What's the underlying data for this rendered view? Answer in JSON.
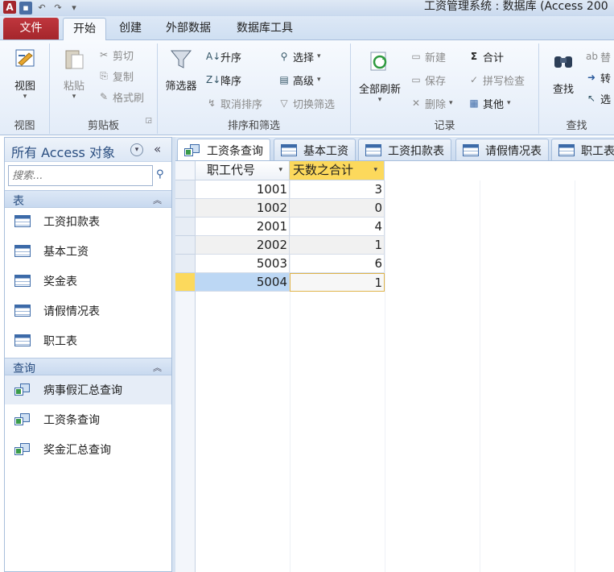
{
  "window": {
    "title": "工资管理系统 : 数据库 (Access 200",
    "app_icon": "A"
  },
  "ribbon_tabs": [
    "文件",
    "开始",
    "创建",
    "外部数据",
    "数据库工具"
  ],
  "ribbon": {
    "view": {
      "label": "视图",
      "group": "视图"
    },
    "clipboard": {
      "paste": "粘贴",
      "cut": "剪切",
      "copy": "复制",
      "format_painter": "格式刷",
      "group": "剪贴板"
    },
    "sort_filter": {
      "filter": "筛选器",
      "ascending": "升序",
      "descending": "降序",
      "remove_sort": "取消排序",
      "selection": "选择",
      "advanced": "高级",
      "toggle_filter": "切换筛选",
      "group": "排序和筛选"
    },
    "records": {
      "refresh_all": "全部刷新",
      "new": "新建",
      "save": "保存",
      "delete": "删除",
      "totals": "合计",
      "spelling": "拼写检查",
      "more": "其他",
      "group": "记录"
    },
    "find": {
      "find": "查找",
      "replace": "替",
      "goto": "转",
      "select": "选",
      "group": "查找"
    }
  },
  "nav_pane": {
    "title": "所有 Access 对象",
    "search_placeholder": "搜索...",
    "sections": [
      {
        "label": "表",
        "items": [
          "工资扣款表",
          "基本工资",
          "奖金表",
          "请假情况表",
          "职工表"
        ]
      },
      {
        "label": "查询",
        "items": [
          "病事假汇总查询",
          "工资条查询",
          "奖金汇总查询"
        ]
      }
    ]
  },
  "doc_tabs": [
    "工资条查询",
    "基本工资",
    "工资扣款表",
    "请假情况表",
    "职工表"
  ],
  "datasheet": {
    "columns": [
      "职工代号",
      "天数之合计"
    ],
    "rows": [
      [
        "1001",
        "3"
      ],
      [
        "1002",
        "0"
      ],
      [
        "2001",
        "4"
      ],
      [
        "2002",
        "1"
      ],
      [
        "5003",
        "6"
      ],
      [
        "5004",
        "1"
      ]
    ]
  },
  "colors": {
    "file_tab": "#a4262c",
    "accent": "#2a4e80",
    "selected_header": "#fcd95c"
  }
}
